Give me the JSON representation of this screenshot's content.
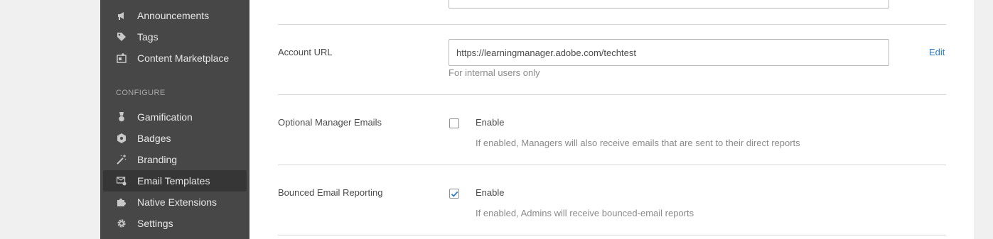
{
  "sidebar": {
    "items_top": [
      {
        "label": "Announcements",
        "icon": "megaphone-icon"
      },
      {
        "label": "Tags",
        "icon": "tag-icon"
      },
      {
        "label": "Content Marketplace",
        "icon": "marketplace-icon"
      }
    ],
    "section_label": "CONFIGURE",
    "items_configure": [
      {
        "label": "Gamification",
        "icon": "medal-icon"
      },
      {
        "label": "Badges",
        "icon": "badge-icon"
      },
      {
        "label": "Branding",
        "icon": "magic-wand-icon"
      },
      {
        "label": "Email Templates",
        "icon": "email-settings-icon",
        "active": true
      },
      {
        "label": "Native Extensions",
        "icon": "puzzle-icon"
      },
      {
        "label": "Settings",
        "icon": "gear-icon"
      }
    ]
  },
  "settings": {
    "account_url": {
      "label": "Account URL",
      "value": "https://learningmanager.adobe.com/techtest",
      "hint": "For internal users only",
      "edit_label": "Edit"
    },
    "optional_manager_emails": {
      "label": "Optional Manager Emails",
      "checked": false,
      "enable_label": "Enable",
      "hint": "If enabled, Managers will also receive emails that are sent to their direct reports"
    },
    "bounced_email_reporting": {
      "label": "Bounced Email Reporting",
      "checked": true,
      "enable_label": "Enable",
      "hint": "If enabled, Admins will receive bounced-email reports"
    }
  },
  "colors": {
    "sidebar_bg": "#474747",
    "sidebar_active_bg": "#363636",
    "link": "#2d7cc3",
    "checkmark": "#2d7cc3"
  }
}
